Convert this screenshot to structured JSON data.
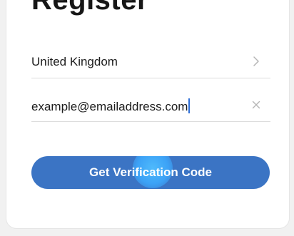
{
  "page": {
    "title": "Register"
  },
  "form": {
    "country": {
      "value": "United Kingdom",
      "icon": "chevron-right-icon"
    },
    "email": {
      "value": "example@emailaddress.com",
      "icon": "clear-icon"
    },
    "submit_label": "Get Verification Code"
  },
  "colors": {
    "accent": "#3b74c4",
    "caret": "#2f6fd8",
    "touch_ripple": "#4fbaff"
  }
}
